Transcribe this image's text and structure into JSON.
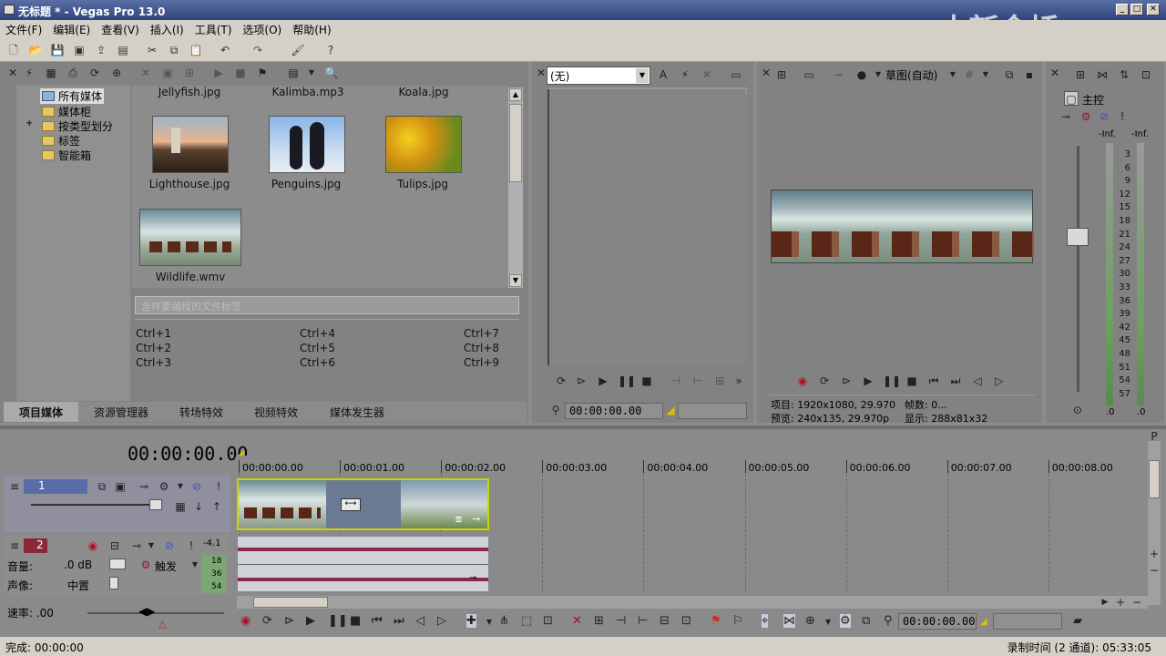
{
  "window": {
    "title": "无标题 * - Vegas Pro 13.0",
    "watermark": "中新金桥"
  },
  "menu": [
    "文件(F)",
    "编辑(E)",
    "查看(V)",
    "插入(I)",
    "工具(T)",
    "选项(O)",
    "帮助(H)"
  ],
  "explorer": {
    "tree": [
      {
        "label": "所有媒体",
        "selected": true
      },
      {
        "label": "媒体柜"
      },
      {
        "label": "按类型划分",
        "expand": "+"
      },
      {
        "label": "标签"
      },
      {
        "label": "智能箱"
      }
    ],
    "top_row": [
      "Jellyfish.jpg",
      "Kalimba.mp3",
      "Koala.jpg"
    ],
    "media": [
      {
        "name": "Lighthouse.jpg"
      },
      {
        "name": "Penguins.jpg"
      },
      {
        "name": "Tulips.jpg"
      },
      {
        "name": "Wildlife.wmv"
      }
    ],
    "search_placeholder": "含样要编程的文件标签",
    "shortcuts": [
      "Ctrl+1",
      "Ctrl+4",
      "Ctrl+7",
      "Ctrl+2",
      "Ctrl+5",
      "Ctrl+8",
      "Ctrl+3",
      "Ctrl+6",
      "Ctrl+9"
    ],
    "tabs": [
      "项目媒体",
      "资源管理器",
      "转场特效",
      "视频特效",
      "媒体发生器"
    ]
  },
  "trimmer": {
    "select_value": "(无)",
    "timecode": "00:00:00.00"
  },
  "preview": {
    "quality": "草图(自动)",
    "info_project": "项目: 1920x1080, 29.970",
    "info_frame": "帧数: 0...",
    "info_preview": "预览: 240x135, 29.970p",
    "info_display": "显示: 288x81x32"
  },
  "master": {
    "label": "主控",
    "inf_left": "-Inf.",
    "inf_right": "-Inf.",
    "scale": [
      "3",
      "6",
      "9",
      "12",
      "15",
      "18",
      "21",
      "24",
      "27",
      "30",
      "33",
      "36",
      "39",
      "42",
      "45",
      "48",
      "51",
      "54",
      "57"
    ],
    "bottom_left": ".0",
    "bottom_right": ".0"
  },
  "timeline": {
    "timecode": "00:00:00.00",
    "ruler": [
      "00:00:00.00",
      "00:00:01.00",
      "00:00:02.00",
      "00:00:03.00",
      "00:00:04.00",
      "00:00:05.00",
      "00:00:06.00",
      "00:00:07.00",
      "00:00:08.00"
    ],
    "track1": {
      "number": "1"
    },
    "track2": {
      "number": "2",
      "level": "-4.1",
      "volume_label": "音量:",
      "volume_value": ".0 dB",
      "pan_label": "声像:",
      "pan_value": "中置",
      "trigger": "触发",
      "meter": [
        "18",
        "36",
        "54"
      ]
    },
    "rate_label": "速率: .00",
    "bottom_timecode": "00:00:00.00"
  },
  "status": {
    "left": "完成: 00:00:00",
    "right": "录制时间 (2 通道): 05:33:05"
  }
}
